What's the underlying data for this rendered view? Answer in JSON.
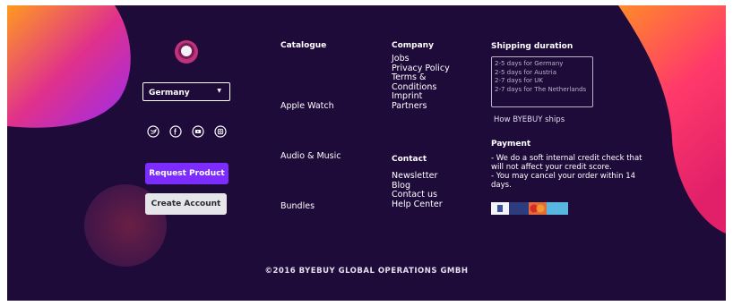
{
  "region": {
    "selected": "Germany"
  },
  "social": [
    "twitter-icon",
    "facebook-icon",
    "youtube-icon",
    "instagram-icon"
  ],
  "buttons": {
    "request": "Request Product",
    "create": "Create Account"
  },
  "catalogue": {
    "heading": "Catalogue",
    "items": [
      "Apple Watch",
      "Audio & Music",
      "Bundles"
    ]
  },
  "company": {
    "heading": "Company",
    "items": [
      "Jobs",
      "Privacy Policy",
      "Terms &",
      "Conditions",
      "Imprint",
      "Partners"
    ]
  },
  "contact": {
    "heading": "Contact",
    "items": [
      "Newsletter",
      "Blog",
      "Contact us",
      "Help Center"
    ]
  },
  "shipping": {
    "heading": "Shipping duration",
    "lines": [
      "2-5 days for Germany",
      "2-5 days for Austria",
      "2-7 days for UK",
      "2-7 days for The Netherlands"
    ],
    "link": "How BYEBUY ships"
  },
  "payment": {
    "heading": "Payment",
    "lines": [
      "- We do a soft internal credit check that",
      "will not affect your credit score.",
      "- You may cancel your order within 14",
      "days."
    ]
  },
  "copyright": "©2016 BYEBUY GLOBAL OPERATIONS GMBH",
  "colors": {
    "background": "#1e0b3a",
    "accent": "#7c2cff",
    "button_light": "#e6e6ea"
  }
}
